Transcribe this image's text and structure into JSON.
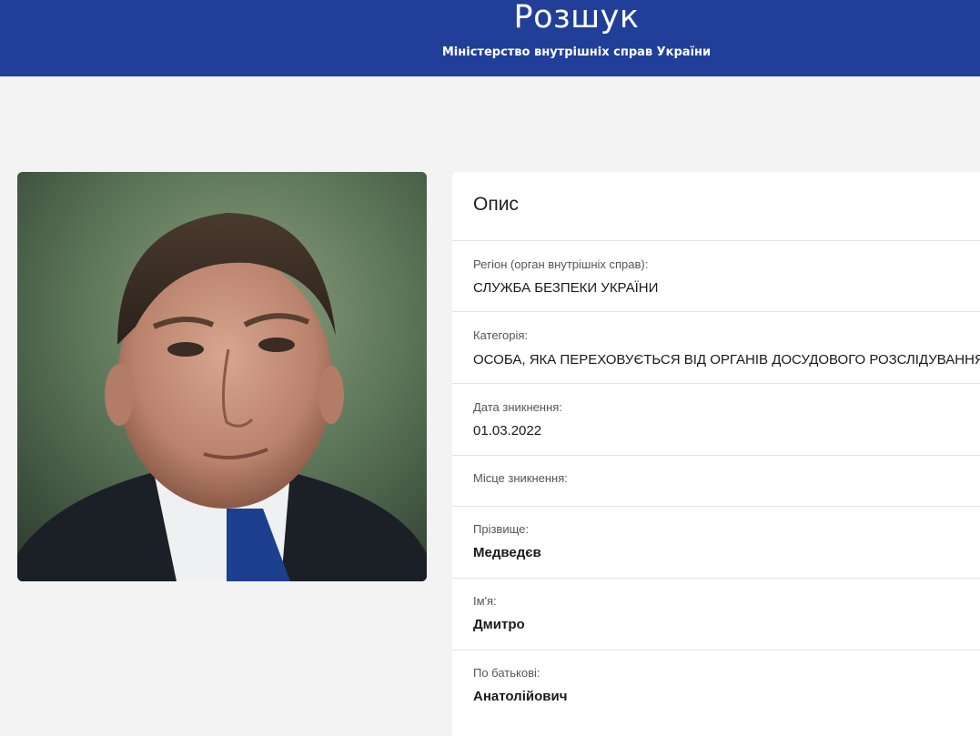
{
  "header": {
    "title": "Розшук",
    "subtitle": "Міністерство внутрішніх справ України",
    "background": "#213f99"
  },
  "photo": {
    "alt": "portrait-photo"
  },
  "card": {
    "title": "Опис",
    "fields": [
      {
        "label": "Регіон (орган внутрішніх справ):",
        "value": "СЛУЖБА БЕЗПЕКИ УКРАЇНИ"
      },
      {
        "label": "Категорія:",
        "value": "ОСОБА, ЯКА ПЕРЕХОВУЄТЬСЯ ВІД ОРГАНІВ ДОСУДОВОГО РОЗСЛІДУВАННЯ"
      },
      {
        "label": "Дата зникнення:",
        "value": "01.03.2022"
      },
      {
        "label": "Місце зникнення:",
        "value": ""
      },
      {
        "label": "Прізвище:",
        "value": "Медведєв"
      },
      {
        "label": "Ім'я:",
        "value": "Дмитро"
      },
      {
        "label": "По батькові:",
        "value": "Анатолійович"
      }
    ]
  }
}
